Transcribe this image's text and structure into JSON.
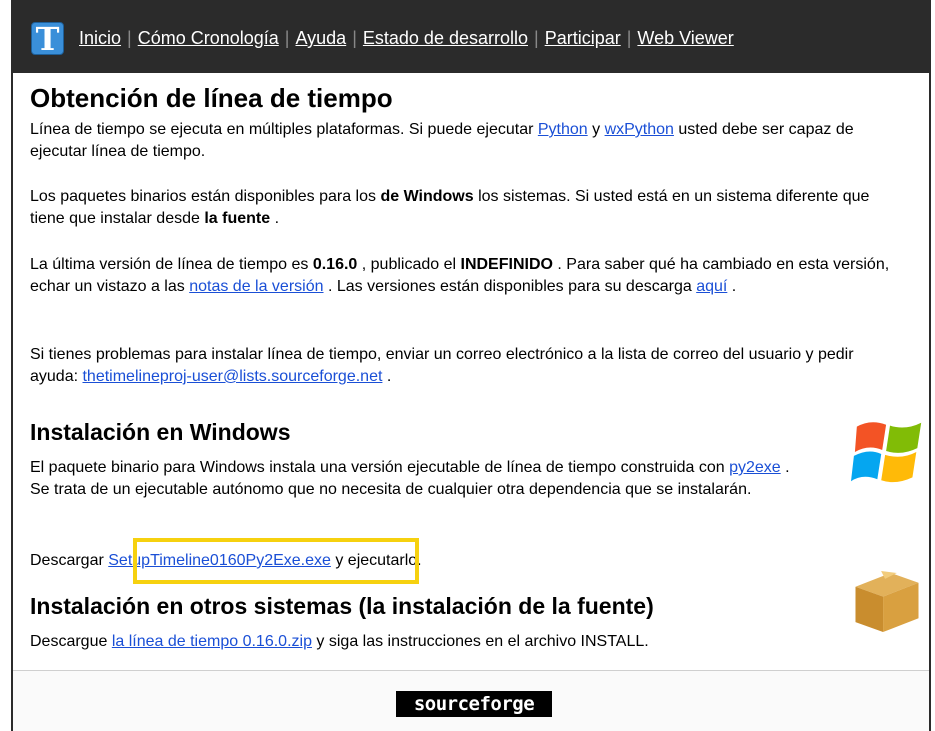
{
  "nav": {
    "logo_letter": "T",
    "items": [
      "Inicio",
      "Cómo Cronología",
      "Ayuda",
      "Estado de desarrollo",
      "Participar",
      "Web Viewer"
    ],
    "separator": "|"
  },
  "main": {
    "title": "Obtención de línea de tiempo",
    "p1": {
      "t1": "Línea de tiempo se ejecuta en múltiples plataformas. Si puede ejecutar ",
      "link_python": "Python",
      "t2": " y ",
      "link_wxpython": "wxPython",
      "t3": " usted debe ser capaz de ejecutar línea de tiempo."
    },
    "p2": {
      "t1": "Los paquetes binarios están disponibles para los ",
      "b1": "de Windows",
      "t2": " los sistemas. Si usted está en un sistema diferente que tiene que instalar desde ",
      "b2": "la fuente",
      "t3": " ."
    },
    "p3": {
      "t1": "La última versión de línea de tiempo es ",
      "version": "0.16.0",
      "t2": " , publicado el ",
      "date": "INDEFINIDO",
      "t3": " . Para saber qué ha cambiado en esta versión, echar un vistazo a las ",
      "link_notes": "notas de la versión",
      "t4": " . Las versiones están disponibles para su descarga ",
      "link_here": "aquí",
      "t5": " ."
    },
    "p4": {
      "t1": "Si tienes problemas para instalar línea de tiempo, enviar un correo electrónico a la lista de correo del usuario y pedir ayuda: ",
      "link_email": "thetimelineproj-user@lists.sourceforge.net",
      "t2": " ."
    }
  },
  "windows": {
    "title": "Instalación en Windows",
    "p1": {
      "t1": "El paquete binario para Windows instala una versión ejecutable de línea de tiempo construida con ",
      "link_py2exe": "py2exe",
      "t2": " . Se trata de un ejecutable autónomo que no necesita de cualquier otra dependencia que se instalarán."
    },
    "p2": {
      "t1": "Descargar ",
      "link_setup": "SetupTimeline0160Py2Exe.exe",
      "t2": " y ejecutarlo."
    }
  },
  "other": {
    "title": "Instalación en otros sistemas (la instalación de la fuente)",
    "p1": {
      "t1": "Descargue ",
      "link_zip": "la línea de tiempo 0.16.0.zip",
      "t2": " y siga las instrucciones en el archivo INSTALL."
    }
  },
  "footer": {
    "logo_text": "sourceforge"
  },
  "colors": {
    "topbar": "#2b2b2b",
    "link": "#1a4fd6",
    "highlight": "#f6d10f"
  }
}
